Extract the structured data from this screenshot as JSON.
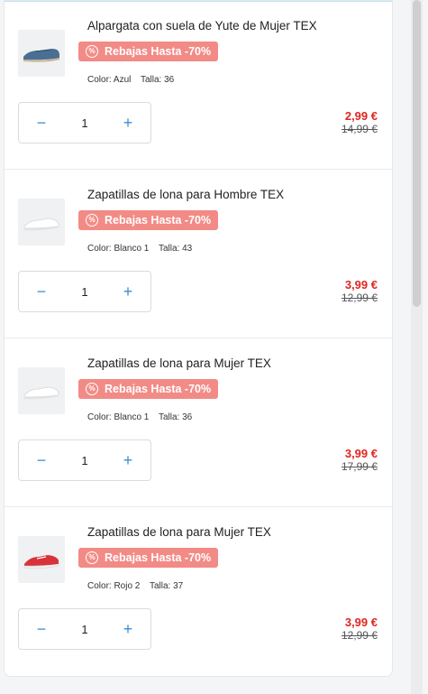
{
  "cart": {
    "items": [
      {
        "title": "Alpargata con suela de Yute de Mujer TEX",
        "promo": "Rebajas Hasta -70%",
        "color": "Color: Azul",
        "size": "Talla: 36",
        "qty": "1",
        "price_now": "2,99 €",
        "price_was": "14,99 €",
        "thumb": "blue-espadrille"
      },
      {
        "title": "Zapatillas de lona para Hombre TEX",
        "promo": "Rebajas Hasta -70%",
        "color": "Color: Blanco 1",
        "size": "Talla: 43",
        "qty": "1",
        "price_now": "3,99 €",
        "price_was": "12,99 €",
        "thumb": "white-sneaker"
      },
      {
        "title": "Zapatillas de lona para Mujer TEX",
        "promo": "Rebajas Hasta -70%",
        "color": "Color: Blanco 1",
        "size": "Talla: 36",
        "qty": "1",
        "price_now": "3,99 €",
        "price_was": "17,99 €",
        "thumb": "white-sneaker"
      },
      {
        "title": "Zapatillas de lona para Mujer TEX",
        "promo": "Rebajas Hasta -70%",
        "color": "Color: Rojo 2",
        "size": "Talla: 37",
        "qty": "1",
        "price_now": "3,99 €",
        "price_was": "12,99 €",
        "thumb": "red-sneaker"
      }
    ],
    "minus_symbol": "−",
    "plus_symbol": "+",
    "promo_icon": "%",
    "colors": {
      "accent": "#3a8fd6",
      "promo": "#f28b86",
      "price": "#e0261e"
    }
  }
}
